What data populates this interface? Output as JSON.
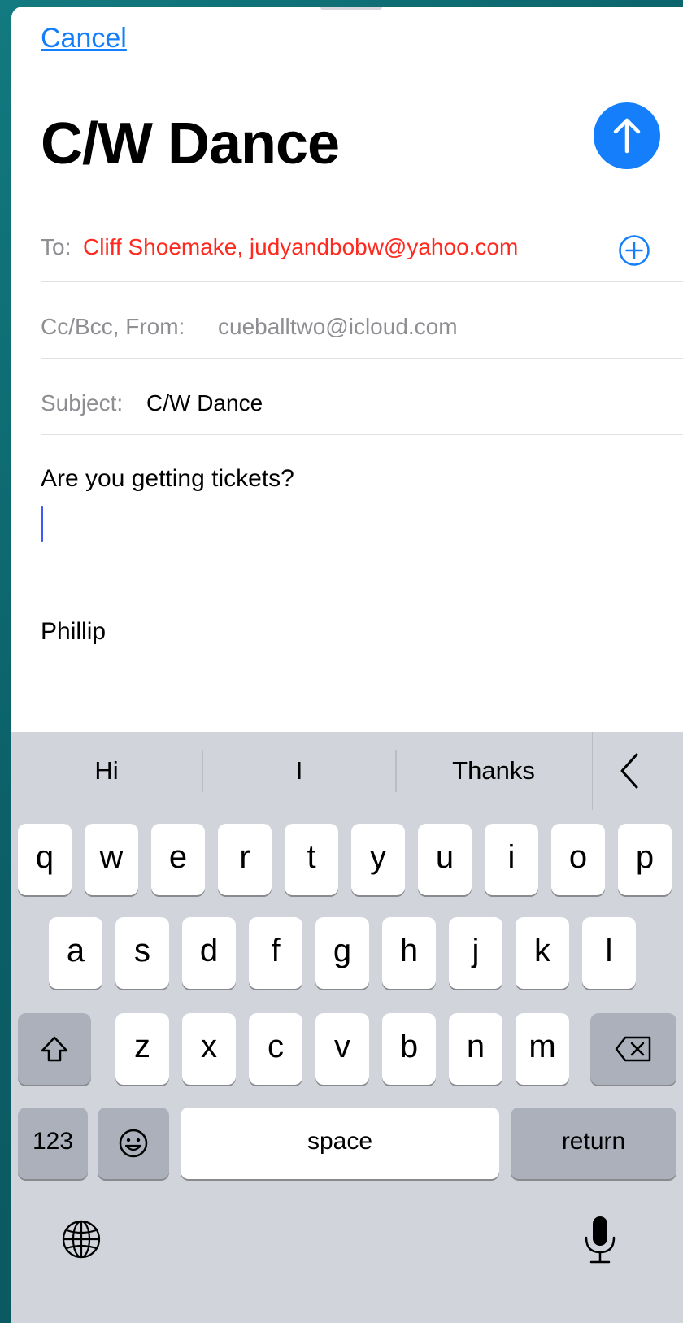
{
  "header": {
    "cancel_label": "Cancel",
    "title": "C/W Dance"
  },
  "fields": {
    "to_label": "To:",
    "to_value": "Cliff Shoemake, judyandbobw@yahoo.com",
    "cc_label": "Cc/Bcc, From:",
    "cc_value": "cueballtwo@icloud.com",
    "subject_label": "Subject:",
    "subject_value": "C/W Dance"
  },
  "body": {
    "line1": "Are you getting tickets?",
    "signature": "Phillip"
  },
  "keyboard": {
    "suggestions": [
      "Hi",
      "I",
      "Thanks"
    ],
    "row1": [
      "q",
      "w",
      "e",
      "r",
      "t",
      "y",
      "u",
      "i",
      "o",
      "p"
    ],
    "row2": [
      "a",
      "s",
      "d",
      "f",
      "g",
      "h",
      "j",
      "k",
      "l"
    ],
    "row3": [
      "z",
      "x",
      "c",
      "v",
      "b",
      "n",
      "m"
    ],
    "numbers_label": "123",
    "space_label": "space",
    "return_label": "return"
  },
  "icons": {
    "send": "arrow-up-circle-icon",
    "add_contact": "plus-circle-icon",
    "shift": "shift-arrow-icon",
    "backspace": "backspace-icon",
    "emoji": "emoji-face-icon",
    "globe": "globe-icon",
    "microphone": "microphone-icon",
    "collapse": "chevron-left-icon"
  },
  "colors": {
    "accent": "#147efb",
    "recipient_invalid": "#ff2a1f",
    "secondary_text": "#8e8e93",
    "keyboard_bg": "#d1d4db",
    "caret": "#3d5af5"
  }
}
